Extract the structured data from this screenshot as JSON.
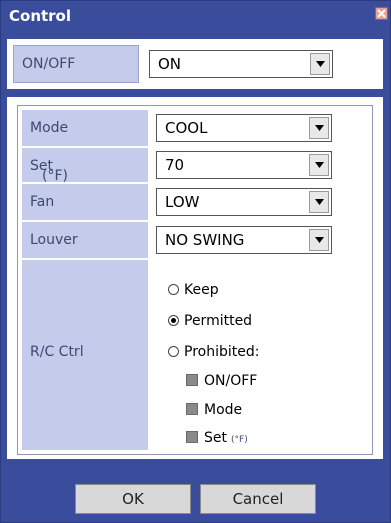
{
  "window": {
    "title": "Control",
    "close_icon": "close-icon"
  },
  "power": {
    "label": "ON/OFF",
    "value": "ON"
  },
  "settings": {
    "mode": {
      "label": "Mode",
      "value": "COOL"
    },
    "set": {
      "label": "Set",
      "unit": "(°F)",
      "value": "70"
    },
    "fan": {
      "label": "Fan",
      "value": "LOW"
    },
    "louver": {
      "label": "Louver",
      "value": "NO SWING"
    },
    "rc_ctrl": {
      "label": "R/C Ctrl",
      "options": [
        "Keep",
        "Permitted",
        "Prohibited:"
      ],
      "selected": "Permitted",
      "prohibited_items": [
        {
          "label": "ON/OFF",
          "unit": ""
        },
        {
          "label": "Mode",
          "unit": ""
        },
        {
          "label": "Set",
          "unit": "(°F)"
        }
      ]
    }
  },
  "buttons": {
    "ok": "OK",
    "cancel": "Cancel"
  },
  "colors": {
    "window_frame": "#3a4d9c",
    "label_bg": "#c5cbeb"
  }
}
